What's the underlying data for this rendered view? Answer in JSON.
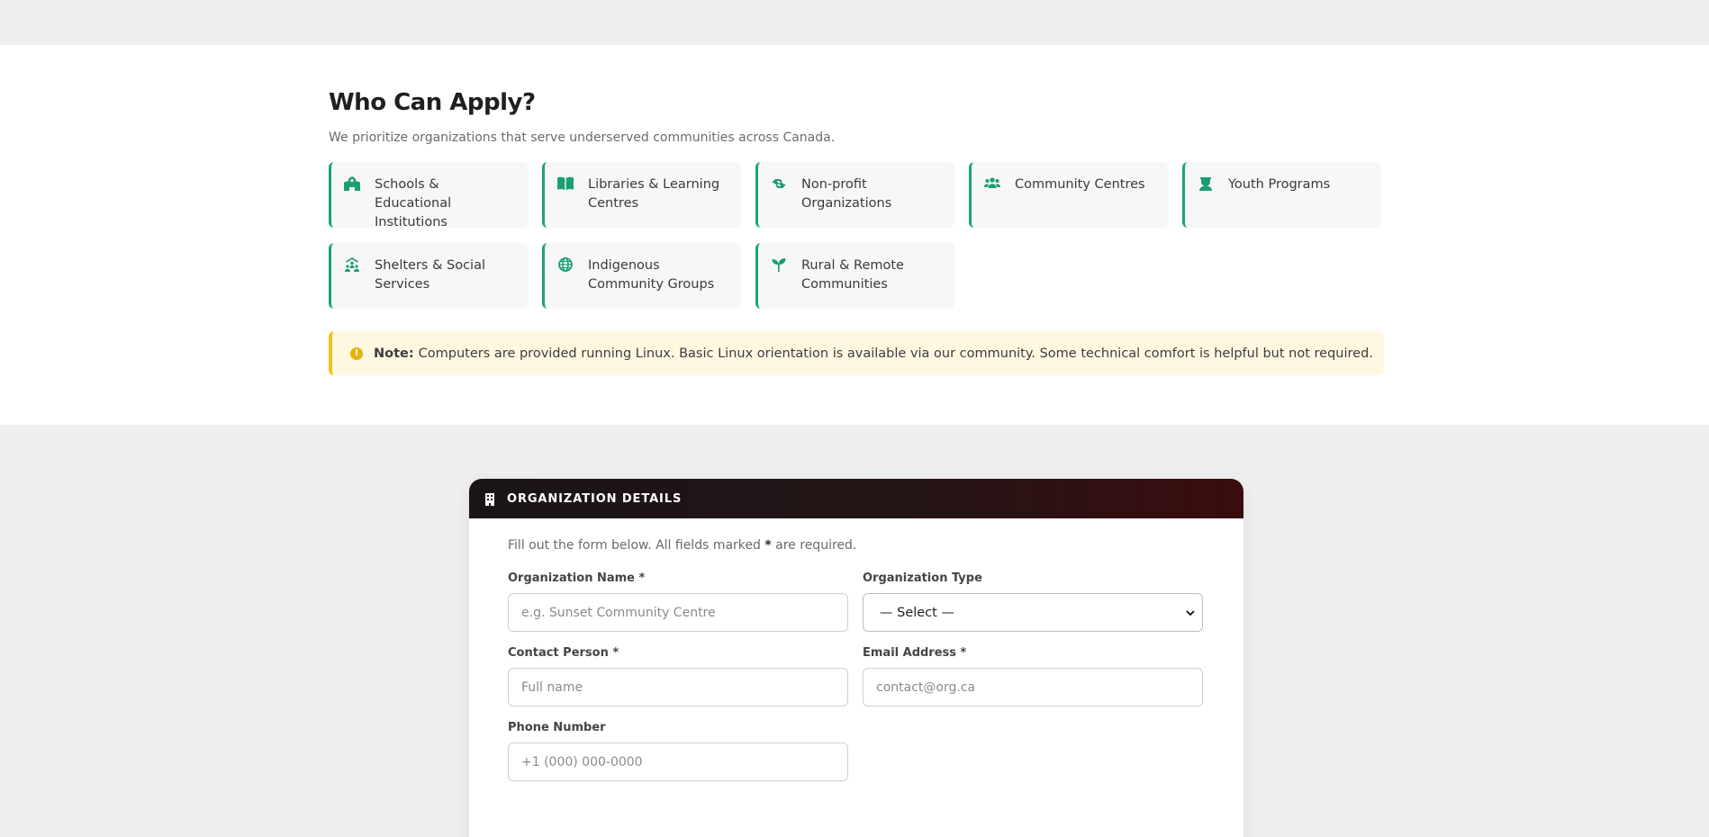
{
  "who": {
    "title": "Who Can Apply?",
    "subtitle": "We prioritize organizations that serve underserved communities across Canada.",
    "items": [
      {
        "label": "Schools & Educational Institutions",
        "icon": "school-icon"
      },
      {
        "label": "Libraries & Learning Centres",
        "icon": "book-icon"
      },
      {
        "label": "Non-profit Organizations",
        "icon": "hands-helping-icon"
      },
      {
        "label": "Community Centres",
        "icon": "users-icon"
      },
      {
        "label": "Youth Programs",
        "icon": "graduate-icon"
      },
      {
        "label": "Shelters & Social Services",
        "icon": "people-roof-icon"
      },
      {
        "label": "Indigenous Community Groups",
        "icon": "globe-icon"
      },
      {
        "label": "Rural & Remote Communities",
        "icon": "seedling-icon"
      }
    ],
    "accent": "#1aa37a"
  },
  "note": {
    "label": "Note:",
    "text": "Computers are provided running Linux. Basic Linux orientation is available via our community. Some technical comfort is helpful but not required.",
    "icon": "warning-icon",
    "accent": "#f2c21b"
  },
  "form": {
    "header_title": "ORGANIZATION DETAILS",
    "header_icon": "building-icon",
    "intro_before": "Fill out the form below. All fields marked",
    "intro_marker": "*",
    "intro_after": "are required.",
    "org_name": {
      "label": "Organization Name *",
      "placeholder": "e.g. Sunset Community Centre",
      "value": ""
    },
    "org_type": {
      "label": "Organization Type",
      "selected": "— Select —"
    },
    "contact": {
      "label": "Contact Person *",
      "placeholder": "Full name",
      "value": ""
    },
    "email": {
      "label": "Email Address *",
      "placeholder": "contact@org.ca",
      "value": ""
    },
    "phone": {
      "label": "Phone Number",
      "placeholder": "+1 (000) 000-0000",
      "value": ""
    }
  }
}
